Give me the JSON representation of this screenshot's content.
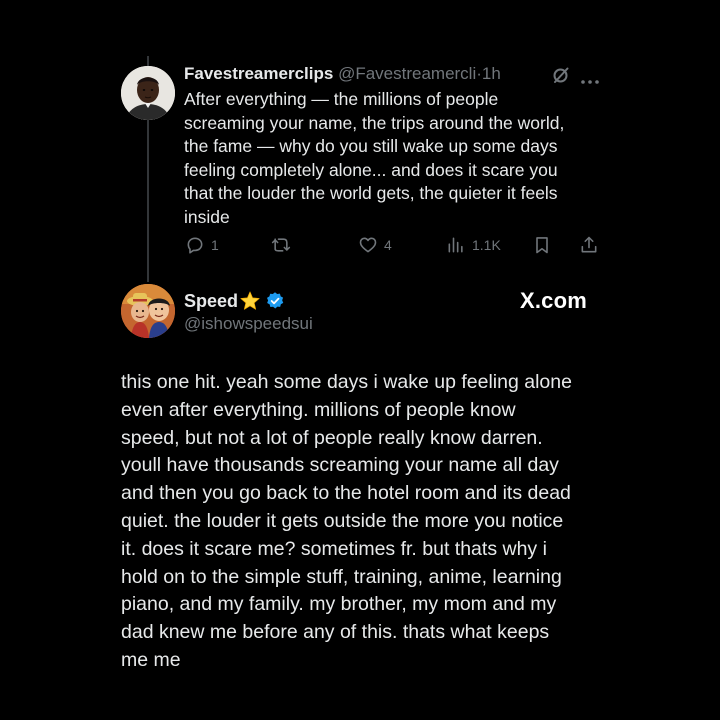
{
  "parent_tweet": {
    "author_name": "Favestreamerclips",
    "author_handle": "@Favestreamercli",
    "separator": "·",
    "time": "1h",
    "text_lines": [
      "After everything — the millions of people",
      "screaming your name, the trips around the world,",
      "the fame — why do you still wake up some days",
      "feeling completely alone... and does it scare you",
      "that the louder the world gets, the quieter it feels",
      "inside"
    ],
    "actions": {
      "reply_count": "1",
      "repost_count": "",
      "like_count": "4",
      "views_count": "1.1K"
    },
    "icons": [
      "grok-icon",
      "more-icon",
      "reply-icon",
      "repost-icon",
      "like-icon",
      "views-icon",
      "bookmark-icon",
      "share-icon"
    ]
  },
  "reply_tweet": {
    "author_name": "Speed",
    "author_handle": "@ishowspeedsui",
    "badge_icons": [
      "star-icon",
      "verified-icon"
    ],
    "source_label": "X.com",
    "text_lines": [
      "this one hit. yeah some days i wake up feeling alone",
      "even after everything. millions of people know",
      "speed, but not a lot of people really know darren.",
      "youll have thousands screaming your name all day",
      "and then you go back to the hotel room and its dead",
      "quiet. the louder it gets outside the more you notice",
      "it. does it scare me? sometimes fr. but thats why i",
      "hold on to the simple stuff, training, anime, learning",
      "piano, and my family. my brother, my mom and my",
      "dad knew me before any of this. thats what keeps",
      "me me"
    ]
  },
  "colors": {
    "background": "#000000",
    "primary_text": "#e7e9ea",
    "secondary_text": "#71767b",
    "verified_blue": "#1d9bf0",
    "star_yellow": "#ffd43b",
    "thread_line": "#333639"
  }
}
